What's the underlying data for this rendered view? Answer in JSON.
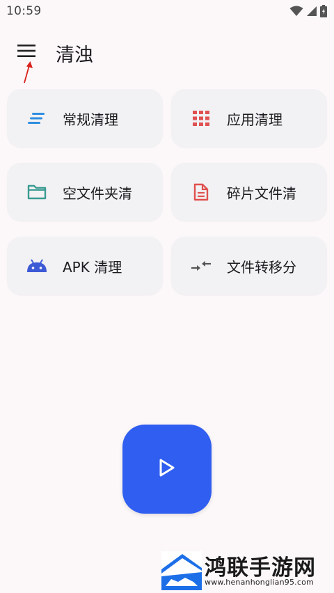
{
  "status_bar": {
    "time": "10:59",
    "icons": [
      "wifi-icon",
      "signal-icon",
      "battery-icon"
    ]
  },
  "app_bar": {
    "title": "清浊",
    "menu_icon": "menu-icon"
  },
  "cards": [
    {
      "label": "常规清理",
      "icon": "sort-lines-icon",
      "color": "#2f8ee0"
    },
    {
      "label": "应用清理",
      "icon": "grid-apps-icon",
      "color": "#e05050"
    },
    {
      "label": "空文件夹清",
      "icon": "folder-icon",
      "color": "#3a9c92"
    },
    {
      "label": "碎片文件清",
      "icon": "document-icon",
      "color": "#e0504d"
    },
    {
      "label": "APK 清理",
      "icon": "android-icon",
      "color": "#3d5ad6"
    },
    {
      "label": "文件转移分",
      "icon": "compress-arrows-icon",
      "color": "#555555"
    }
  ],
  "fab": {
    "icon": "play-icon",
    "color": "#2f5ef0"
  },
  "watermark": {
    "name": "鸿联手游网",
    "url": "www.henanhonglian95.com"
  }
}
